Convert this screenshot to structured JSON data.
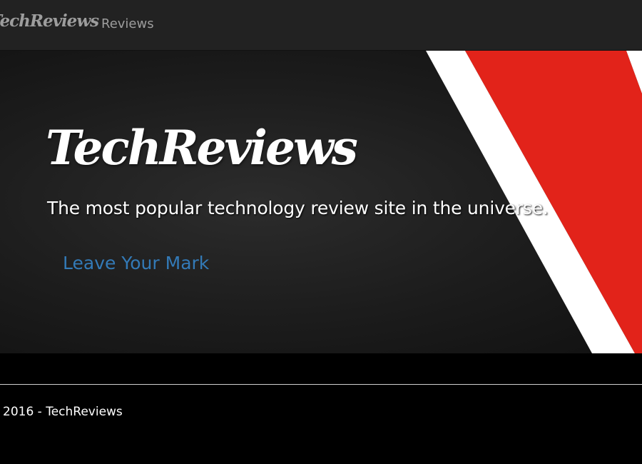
{
  "navbar": {
    "brand": "TechReviews",
    "links": [
      {
        "label": "Reviews"
      }
    ]
  },
  "hero": {
    "title": "TechReviews",
    "subtitle": "The most popular technology review site in the universe.",
    "cta_label": "Leave Your Mark",
    "stripe_colors": {
      "white": "#ffffff",
      "red": "#e2231a",
      "background": "#1c1c1c"
    }
  },
  "footer": {
    "copyright": "2016 - TechReviews"
  },
  "colors": {
    "navbar_bg": "#222222",
    "nav_text": "#9d9d9d",
    "link_blue": "#337ab7",
    "page_bg": "#000000"
  }
}
